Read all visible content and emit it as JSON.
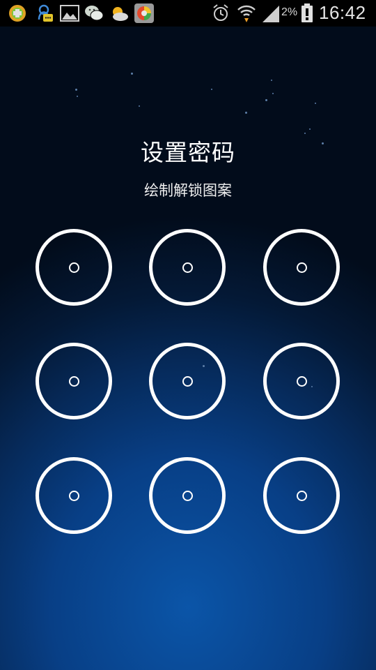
{
  "status_bar": {
    "battery_percent": "2%",
    "time": "16:42",
    "notification_icons": [
      "game-app-icon",
      "qq-chat-icon",
      "gallery-icon",
      "wechat-icon",
      "weather-icon",
      "browser-app-icon"
    ],
    "status_icons": [
      "alarm-icon",
      "wifi-icon",
      "cell-signal-icon",
      "battery-low-icon"
    ]
  },
  "lock": {
    "title": "设置密码",
    "subtitle": "绘制解锁图案"
  },
  "pattern_grid": {
    "rows": 3,
    "columns": 3
  },
  "colors": {
    "accent": "#ffffff",
    "background_top": "#020c1b",
    "background_bottom": "#0b55a8"
  }
}
